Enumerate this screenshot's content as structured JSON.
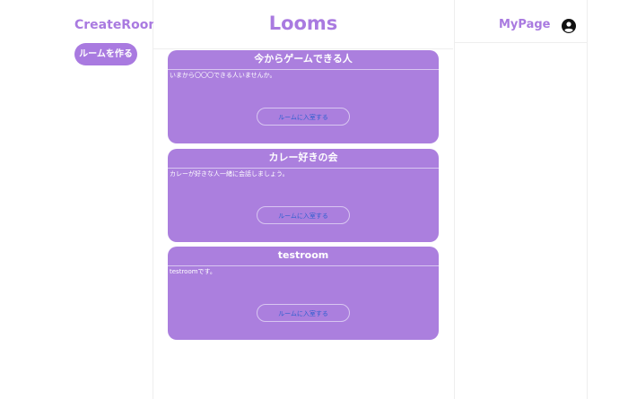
{
  "sidebar": {
    "create_room_title": "CreateRoom",
    "create_room_button": "ルームを作る"
  },
  "header": {
    "app_title": "Looms",
    "mypage_label": "MyPage",
    "user_icon": "user-circle-icon"
  },
  "rooms": [
    {
      "title": "今からゲームできる人",
      "description": "いまから〇〇〇できる人いませんか。",
      "join_label": "ルームに入室する"
    },
    {
      "title": "カレー好きの会",
      "description": "カレーが好きな人一緒に会話しましょう。",
      "join_label": "ルームに入室する"
    },
    {
      "title": "testroom",
      "description": "testroomです。",
      "join_label": "ルームに入室する"
    }
  ],
  "colors": {
    "accent": "#a97ae0",
    "card": "#ab7fde",
    "link": "#2f5fcf"
  }
}
